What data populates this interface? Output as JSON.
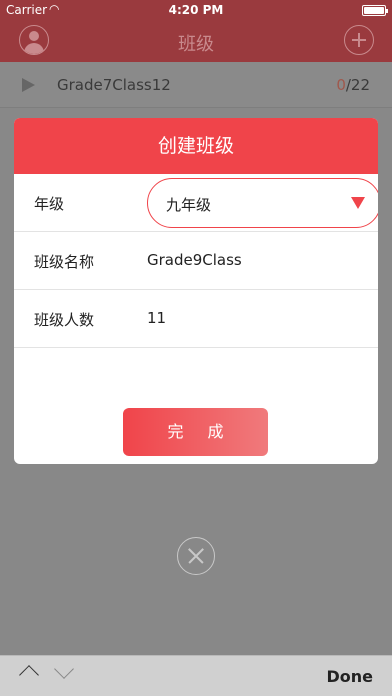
{
  "status_bar": {
    "carrier": "Carrier",
    "wifi_icon": "wifi-icon",
    "time": "4:20 PM",
    "battery_level": 0.92
  },
  "nav": {
    "title": "班级",
    "left_icon": "user-avatar-icon",
    "right_icon": "add-circle-icon"
  },
  "list": {
    "items": [
      {
        "name": "Grade7Class12",
        "current": "0",
        "total": "/22"
      }
    ]
  },
  "dialog": {
    "title": "创建班级",
    "grade": {
      "label": "年级",
      "selected": "九年级"
    },
    "class_name": {
      "label": "班级名称",
      "value": "Grade9Class"
    },
    "student_count": {
      "label": "班级人数",
      "value": "11"
    },
    "done_label": "完成",
    "accent_color": "#f0444a"
  },
  "keyboard_toolbar": {
    "done_label": "Done"
  }
}
